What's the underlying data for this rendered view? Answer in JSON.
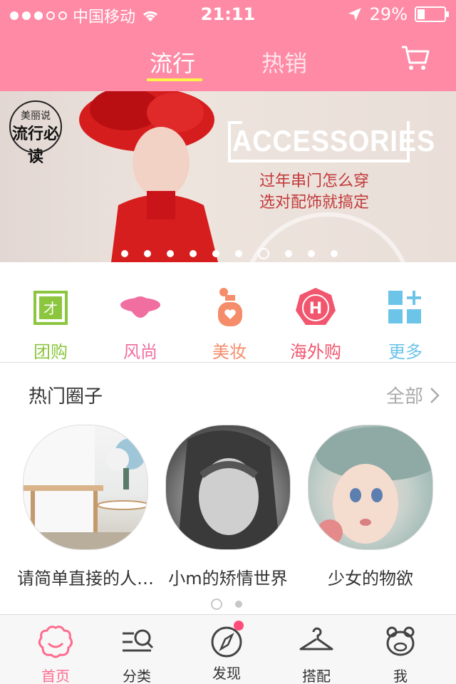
{
  "status": {
    "carrier": "中国移动",
    "time": "21:11",
    "battery": "29%",
    "battery_level": 0.29,
    "signal_bars": 3
  },
  "nav": {
    "tabs": [
      {
        "label": "流行",
        "active": true
      },
      {
        "label": "热销",
        "active": false
      }
    ],
    "cart_icon": "cart-icon"
  },
  "banner": {
    "badge_line1": "美丽说",
    "badge_line2": "流行必读",
    "headline": "ACCESSORIES",
    "subtitle1": "过年串门怎么穿",
    "subtitle2": "选对配饰就搞定",
    "page_count": 10,
    "active_page": 7
  },
  "categories": [
    {
      "label": "团购",
      "icon": "group-buy-icon",
      "color": "#8cc63f"
    },
    {
      "label": "风尚",
      "icon": "fashion-hat-icon",
      "color": "#f06fa0"
    },
    {
      "label": "美妆",
      "icon": "perfume-icon",
      "color": "#f58c6a"
    },
    {
      "label": "海外购",
      "icon": "overseas-h-icon",
      "color": "#f2566e"
    },
    {
      "label": "更多",
      "icon": "more-grid-icon",
      "color": "#6cc4e8"
    }
  ],
  "hot": {
    "title": "热门圈子",
    "all_label": "全部",
    "circles": [
      {
        "label": "请简单直接的人…"
      },
      {
        "label": "小m的矫情世界"
      },
      {
        "label": "少女的物欲"
      }
    ],
    "pages": 2,
    "active_page": 1
  },
  "tabbar": {
    "items": [
      {
        "label": "首页",
        "icon": "home-flower-icon",
        "active": true
      },
      {
        "label": "分类",
        "icon": "category-search-icon",
        "active": false
      },
      {
        "label": "发现",
        "icon": "compass-icon",
        "active": false,
        "badge": true
      },
      {
        "label": "搭配",
        "icon": "hanger-icon",
        "active": false
      },
      {
        "label": "我",
        "icon": "profile-bear-icon",
        "active": false
      }
    ]
  },
  "colors": {
    "header_pink": "#ff8aa6",
    "tab_underline": "#fff34a",
    "active_tab": "#ff6a8e",
    "banner_text_red": "#c23b3b"
  }
}
